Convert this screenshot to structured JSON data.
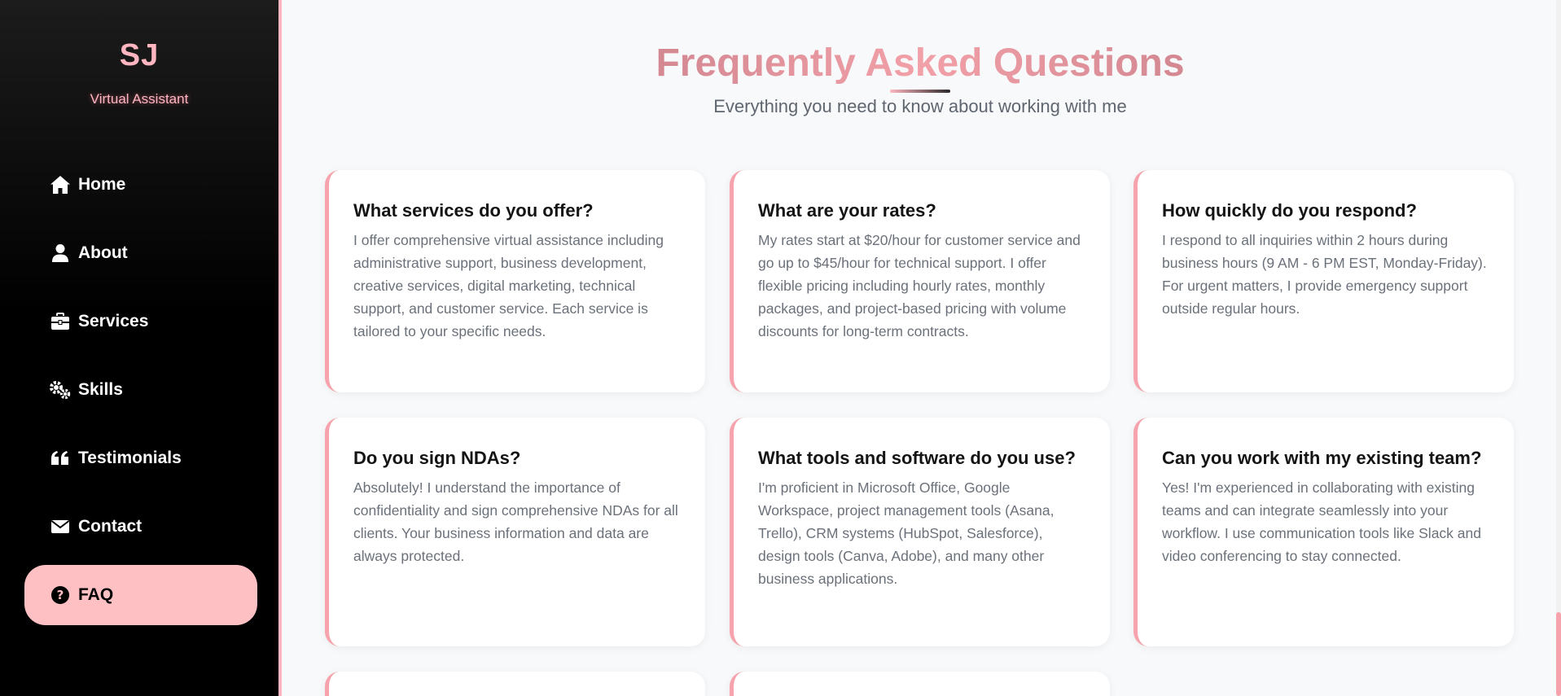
{
  "sidebar": {
    "logo": "SJ",
    "tagline": "Virtual Assistant",
    "items": [
      {
        "label": "Home",
        "icon": "home-icon"
      },
      {
        "label": "About",
        "icon": "user-icon"
      },
      {
        "label": "Services",
        "icon": "briefcase-icon"
      },
      {
        "label": "Skills",
        "icon": "gears-icon"
      },
      {
        "label": "Testimonials",
        "icon": "quote-icon"
      },
      {
        "label": "Contact",
        "icon": "envelope-icon"
      },
      {
        "label": "FAQ",
        "icon": "question-circle-icon",
        "active": true
      }
    ]
  },
  "faq": {
    "title": "Frequently Asked Questions",
    "subtitle": "Everything you need to know about working with me",
    "items": [
      {
        "question": "What services do you offer?",
        "answer": "I offer comprehensive virtual assistance including administrative support, business development, creative services, digital marketing, technical support, and customer service. Each service is tailored to your specific needs."
      },
      {
        "question": "What are your rates?",
        "answer": "My rates start at $20/hour for customer service and go up to $45/hour for technical support. I offer flexible pricing including hourly rates, monthly packages, and project-based pricing with volume discounts for long-term contracts."
      },
      {
        "question": "How quickly do you respond?",
        "answer": "I respond to all inquiries within 2 hours during business hours (9 AM - 6 PM EST, Monday-Friday). For urgent matters, I provide emergency support outside regular hours."
      },
      {
        "question": "Do you sign NDAs?",
        "answer": "Absolutely! I understand the importance of confidentiality and sign comprehensive NDAs for all clients. Your business information and data are always protected."
      },
      {
        "question": "What tools and software do you use?",
        "answer": "I'm proficient in Microsoft Office, Google Workspace, project management tools (Asana, Trello), CRM systems (HubSpot, Salesforce), design tools (Canva, Adobe), and many other business applications."
      },
      {
        "question": "Can you work with my existing team?",
        "answer": "Yes! I'm experienced in collaborating with existing teams and can integrate seamlessly into your workflow. I use communication tools like Slack and video conferencing to stay connected."
      }
    ]
  },
  "colors": {
    "accent": "#ffb6c1",
    "active_nav": "#ffc0c4",
    "card_border": "#f7a3ad",
    "sidebar_bg": "#000000",
    "page_bg": "#f8f9fa"
  }
}
